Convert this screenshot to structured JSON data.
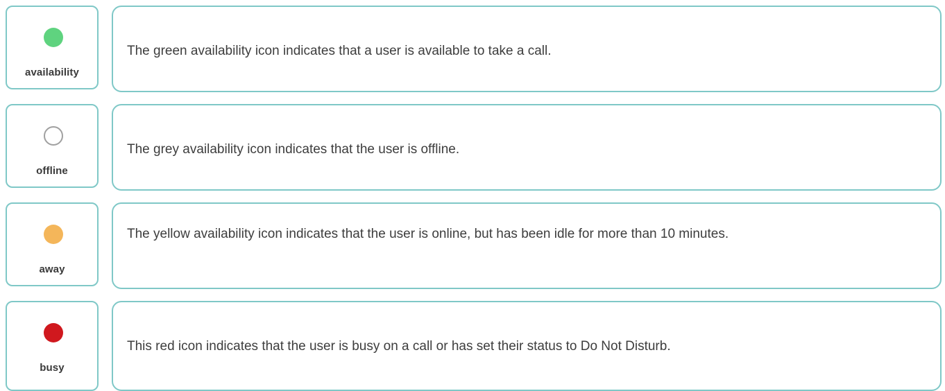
{
  "statuses": [
    {
      "label": "availability",
      "icon": "green-dot-icon",
      "color": "#5fd37f",
      "filled": true,
      "description": "The green availability icon indicates that a user is available to take a call."
    },
    {
      "label": "offline",
      "icon": "grey-ring-icon",
      "color": "#a0a0a0",
      "filled": false,
      "description": "The grey availability icon indicates that the user is offline."
    },
    {
      "label": "away",
      "icon": "yellow-dot-icon",
      "color": "#f4b65a",
      "filled": true,
      "description": "The yellow availability icon indicates that the user is online, but has been idle for more than 10 minutes."
    },
    {
      "label": "busy",
      "icon": "red-dot-icon",
      "color": "#d0181e",
      "filled": true,
      "description": "This red icon indicates that the user is busy on a call or has set their status to Do Not Disturb."
    }
  ]
}
